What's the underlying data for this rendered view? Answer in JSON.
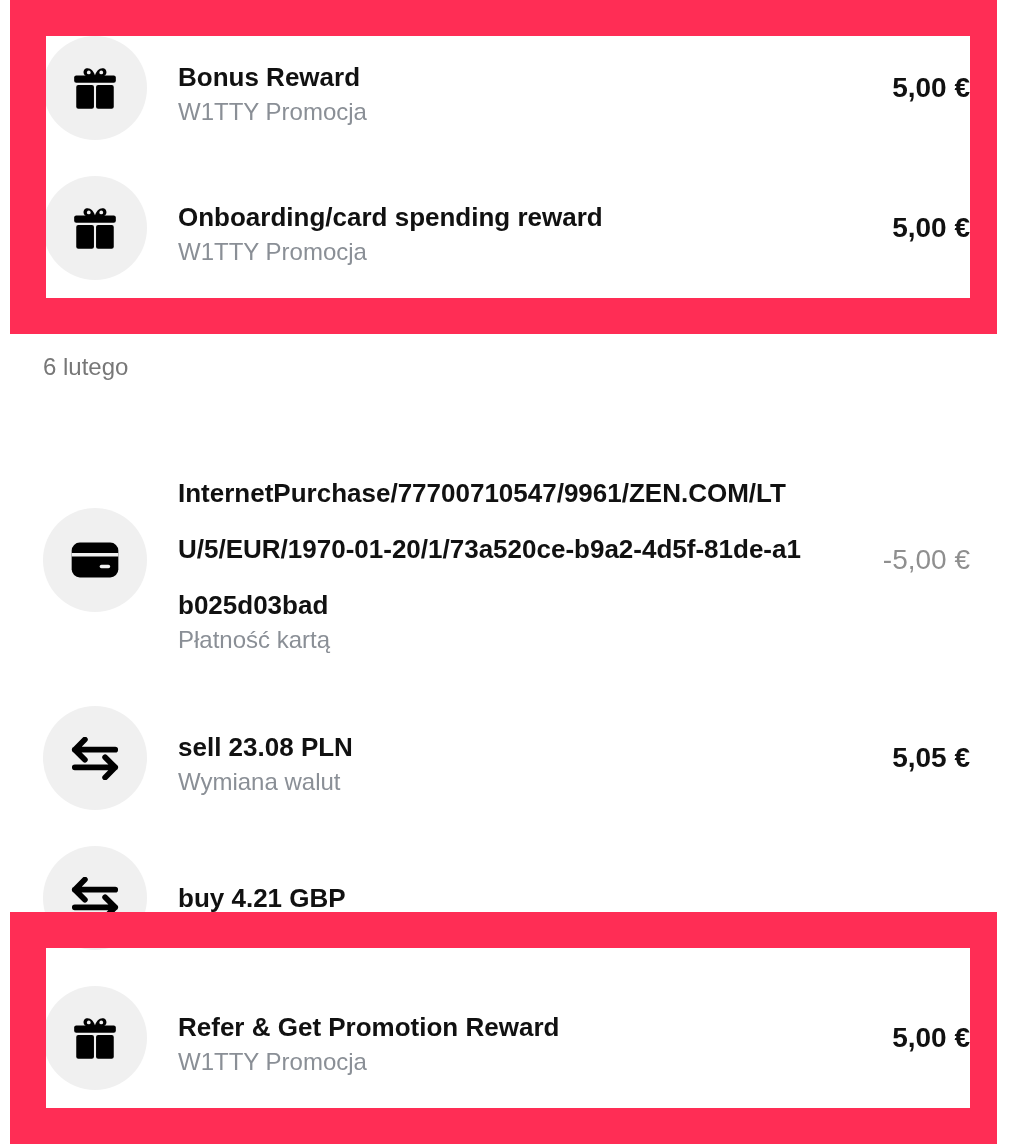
{
  "sections": [
    {
      "transactions": [
        {
          "kind": "gift",
          "title": "Bonus Reward",
          "subtitle": "W1TTY Promocja",
          "amount": "5,00 €",
          "muted": false,
          "highlighted": true
        },
        {
          "kind": "gift",
          "title": "Onboarding/card spending reward",
          "subtitle": "W1TTY Promocja",
          "amount": "5,00 €",
          "muted": false,
          "highlighted": true
        }
      ]
    },
    {
      "date": "6 lutego",
      "transactions": [
        {
          "kind": "card",
          "title": "InternetPurchase/77700710547/9961/ZEN.COM/LTU/5/EUR/1970-01-20/1/73a520ce-b9a2-4d5f-81de-a1b025d03bad",
          "subtitle": "Płatność kartą",
          "amount": "-5,00 €",
          "muted": true,
          "highlighted": false
        },
        {
          "kind": "exchange",
          "title": "sell 23.08 PLN",
          "subtitle": "Wymiana walut",
          "amount": "5,05 €",
          "muted": false,
          "highlighted": false
        },
        {
          "kind": "exchange",
          "title": "buy 4.21 GBP",
          "highlighted": false
        },
        {
          "kind": "gift",
          "title": "Refer & Get Promotion Reward",
          "subtitle": "W1TTY Promocja",
          "amount": "5,00 €",
          "muted": false,
          "highlighted": true
        }
      ]
    }
  ]
}
